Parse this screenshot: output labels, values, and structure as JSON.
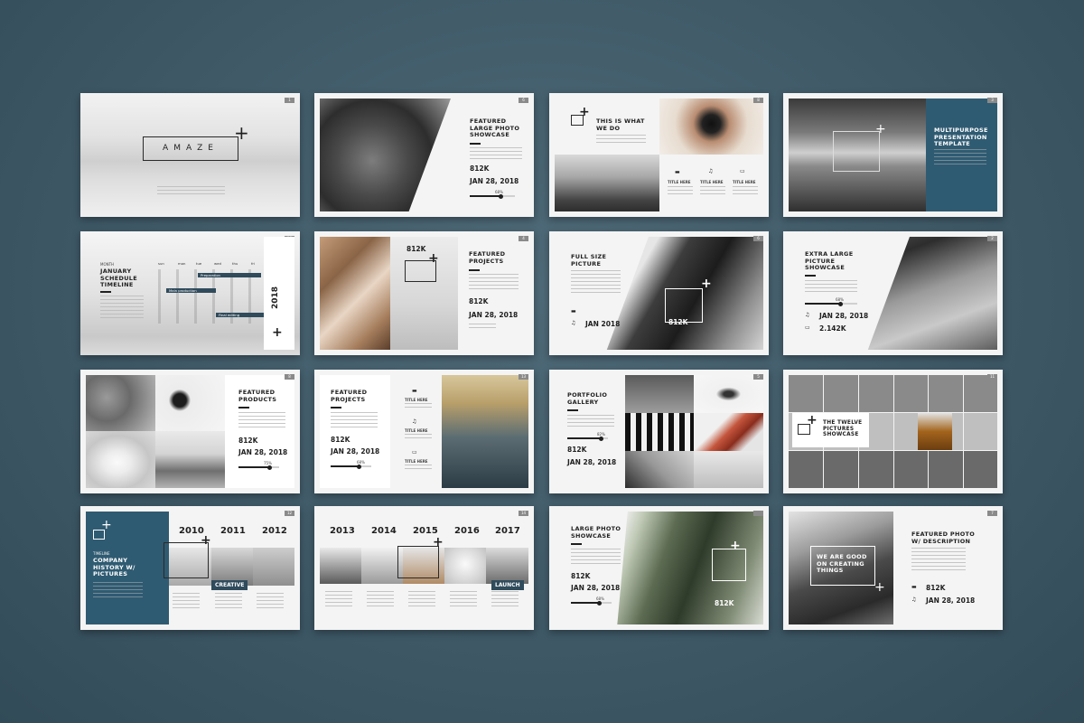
{
  "slides": [
    {
      "id": "s1",
      "number": "1",
      "brand": "AMAZE"
    },
    {
      "id": "s2",
      "number": "6",
      "title": "FEATURED LARGE PHOTO SHOWCASE",
      "stat": "812K",
      "date": "JAN 28, 2018",
      "progress": 68,
      "progress_label": "68%"
    },
    {
      "id": "s3",
      "number": "8",
      "title": "THIS IS WHAT WE DO",
      "items": [
        "TITLE HERE",
        "TITLE HERE",
        "TITLE HERE"
      ]
    },
    {
      "id": "s4",
      "number": "3",
      "title": "MULTIPURPOSE PRESENTATION TEMPLATE"
    },
    {
      "id": "s5",
      "number": "16",
      "month": "MONTH",
      "title": "JANUARY SCHEDULE TIMELINE",
      "year": "2018",
      "days": [
        "sun",
        "mon",
        "tue",
        "wed",
        "thu",
        "fri",
        "sat"
      ],
      "events": [
        "Preparation",
        "Main production",
        "Final editing"
      ]
    },
    {
      "id": "s6",
      "number": "4",
      "stat_top": "812K",
      "title": "FEATURED PROJECTS",
      "stat": "812K",
      "date": "JAN 28, 2018"
    },
    {
      "id": "s7",
      "number": "6",
      "title": "FULL SIZE PICTURE",
      "date": "JAN 2018",
      "stat": "812K"
    },
    {
      "id": "s8",
      "number": "2",
      "title": "EXTRA LARGE PICTURE SHOWCASE",
      "progress": 68,
      "progress_label": "68%",
      "date": "JAN 28, 2018",
      "stat": "2.142K"
    },
    {
      "id": "s9",
      "number": "8",
      "title": "FEATURED PRODUCTS",
      "stat": "812K",
      "date": "JAN 28, 2018",
      "progress": 75,
      "progress_label": "75%"
    },
    {
      "id": "s10",
      "number": "13",
      "title": "FEATURED PROJECTS",
      "stat": "812K",
      "date": "JAN 28, 2018",
      "progress": 68,
      "progress_label": "68%",
      "items": [
        "TITLE HERE",
        "TITLE HERE",
        "TITLE HERE"
      ]
    },
    {
      "id": "s11",
      "number": "5",
      "title": "PORTFOLIO GALLERY",
      "progress": 82,
      "progress_label": "82%",
      "stat": "812K",
      "date": "JAN 28, 2018"
    },
    {
      "id": "s12",
      "number": "11",
      "title": "THE TWELVE PICTURES SHOWCASE"
    },
    {
      "id": "s13",
      "number": "12",
      "timeline": "TIMELINE",
      "title": "COMPANY HISTORY W/ PICTURES",
      "years": [
        "2010",
        "2011",
        "2012"
      ],
      "tag": "CREATIVE"
    },
    {
      "id": "s14",
      "number": "14",
      "years": [
        "2013",
        "2014",
        "2015",
        "2016",
        "2017"
      ],
      "tag": "LAUNCH"
    },
    {
      "id": "s15",
      "number": "",
      "title": "LARGE PHOTO SHOWCASE",
      "stat": "812K",
      "date": "JAN 28, 2018",
      "progress": 68,
      "progress_label": "68%",
      "stat2": "812K"
    },
    {
      "id": "s16",
      "number": "7",
      "title": "FEATURED PHOTO W/ DESCRIPTION",
      "caption": "WE ARE GOOD ON CREATING THINGS",
      "stat": "812K",
      "date": "JAN 28, 2018"
    }
  ]
}
